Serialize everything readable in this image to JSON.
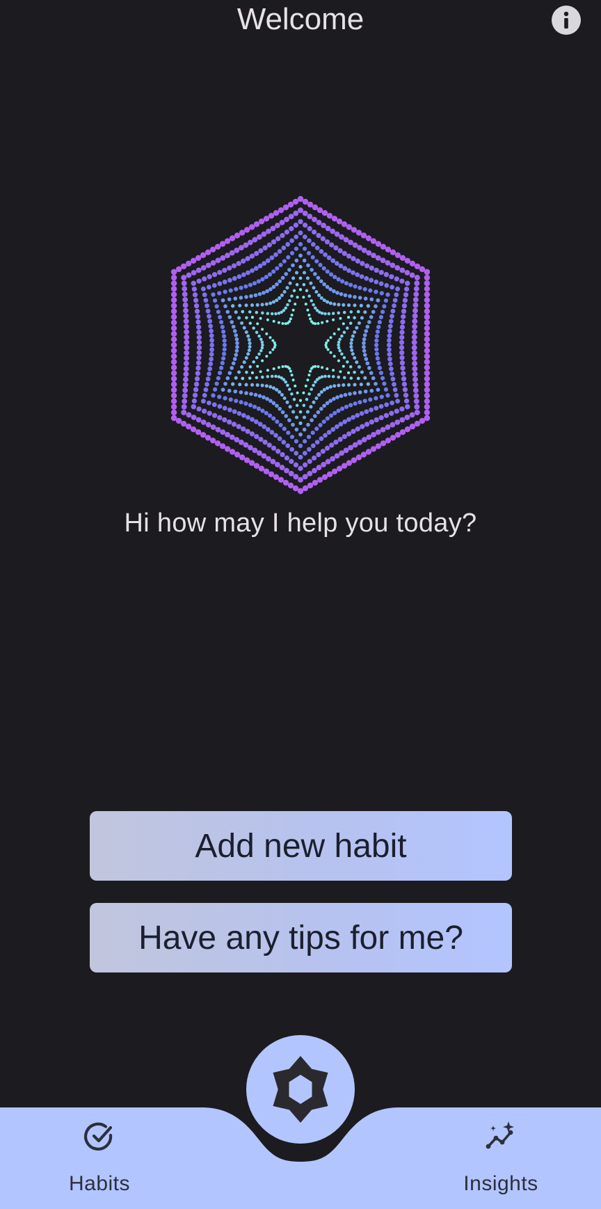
{
  "app_bar": {
    "title": "Welcome",
    "info_icon": "info-icon"
  },
  "assistant": {
    "orb_icon": "hexagon-orb",
    "prompt": "Hi how may I help you today?"
  },
  "actions": {
    "add_habit_label": "Add new habit",
    "tips_label": "Have any tips for me?"
  },
  "bottom_nav": {
    "items": [
      {
        "label": "Habits",
        "icon": "check-circle-icon"
      },
      {
        "label": "Insights",
        "icon": "sparkle-trend-icon"
      }
    ],
    "center_icon": "assistant-orb-icon"
  },
  "colors": {
    "background": "#1c1b1f",
    "nav": "#b3c5ff",
    "button_start": "#c1c6dd",
    "button_end": "#b3c5ff",
    "dot_outer": "#b060f0",
    "dot_mid": "#6b78f0",
    "dot_inner": "#7ef0ea"
  }
}
